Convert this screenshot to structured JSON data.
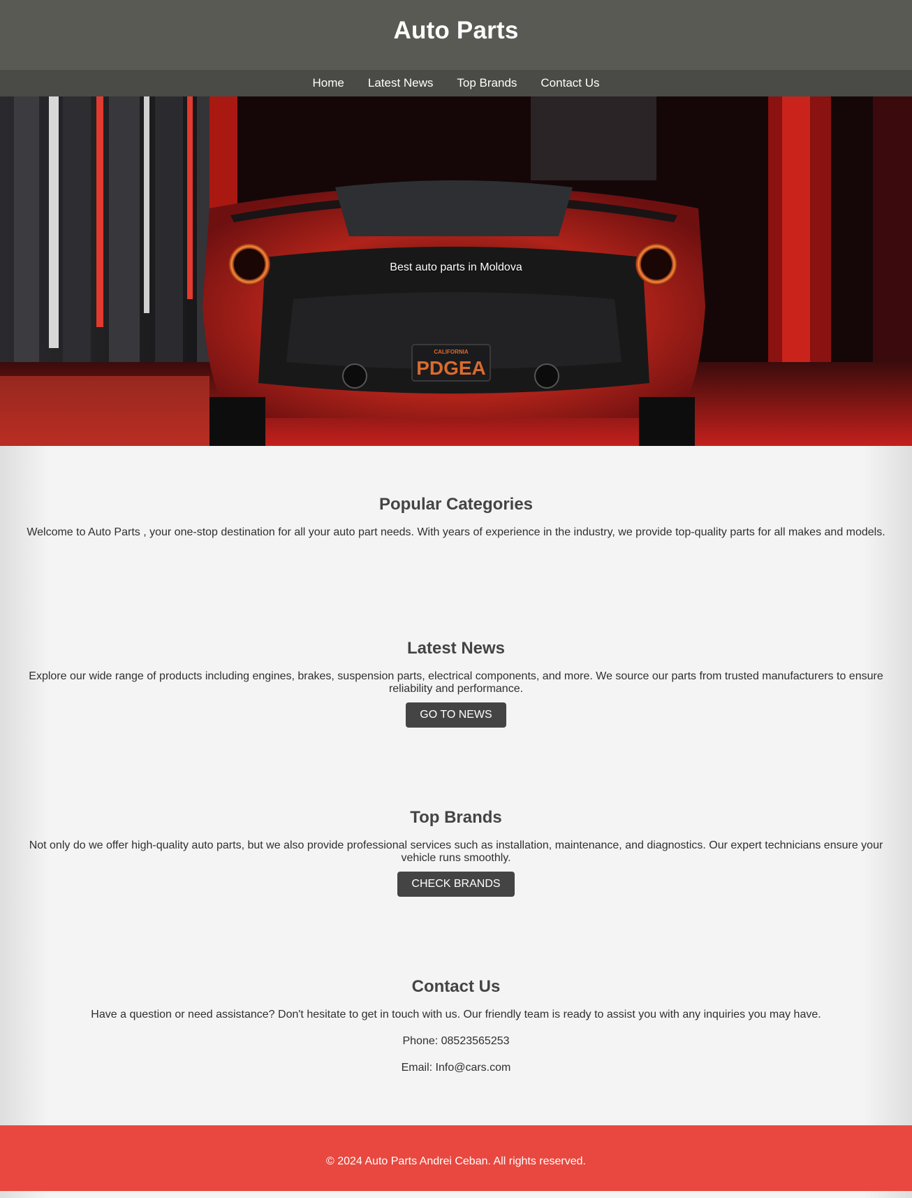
{
  "header": {
    "title": "Auto Parts"
  },
  "nav": {
    "items": [
      "Home",
      "Latest News",
      "Top Brands",
      "Contact Us"
    ]
  },
  "hero": {
    "tagline": "Best auto parts in Moldova",
    "plate_state": "CALIFORNIA",
    "plate_number": "PDGEA"
  },
  "sections": {
    "categories": {
      "title": "Popular Categories",
      "text": "Welcome to Auto Parts , your one-stop destination for all your auto part needs. With years of experience in the industry, we provide top-quality parts for all makes and models."
    },
    "news": {
      "title": "Latest News",
      "text": "Explore our wide range of products including engines, brakes, suspension parts, electrical components, and more. We source our parts from trusted manufacturers to ensure reliability and performance.",
      "button": "GO TO NEWS"
    },
    "brands": {
      "title": "Top Brands",
      "text": "Not only do we offer high-quality auto parts, but we also provide professional services such as installation, maintenance, and diagnostics. Our expert technicians ensure your vehicle runs smoothly.",
      "button": "CHECK BRANDS"
    },
    "contact": {
      "title": "Contact Us",
      "text": "Have a question or need assistance? Don't hesitate to get in touch with us. Our friendly team is ready to assist you with any inquiries you may have.",
      "phone": "Phone: 08523565253",
      "email": "Email: Info@cars.com"
    }
  },
  "footer": {
    "text": "© 2024 Auto Parts Andrei Ceban. All rights reserved."
  },
  "colors": {
    "header_bg": "#5a5a55",
    "nav_bg": "#4a4a46",
    "footer_bg": "#e8483f",
    "button_bg": "#444444",
    "page_bg": "#f4f4f4"
  }
}
